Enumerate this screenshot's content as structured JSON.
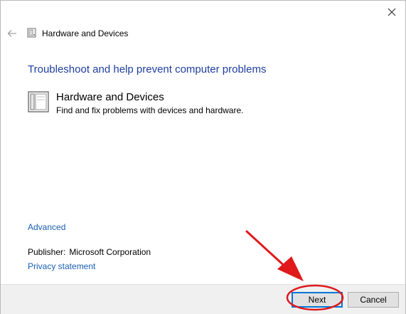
{
  "window": {
    "header_title": "Hardware and Devices",
    "close_icon": "close-icon",
    "back_icon": "back-arrow-icon"
  },
  "main": {
    "heading": "Troubleshoot and help prevent computer problems",
    "task": {
      "icon": "hardware-devices-icon",
      "title": "Hardware and Devices",
      "description": "Find and fix problems with devices and hardware."
    },
    "advanced_link": "Advanced",
    "publisher_label": "Publisher:",
    "publisher_value": "Microsoft Corporation",
    "privacy_link": "Privacy statement"
  },
  "footer": {
    "next_label": "Next",
    "cancel_label": "Cancel"
  },
  "colors": {
    "heading": "#1e3fa0",
    "link": "#1a5fb4",
    "annotation": "#e0191b",
    "focus_border": "#0078d7"
  }
}
